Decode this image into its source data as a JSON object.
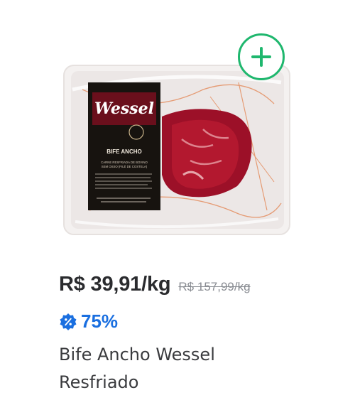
{
  "product": {
    "name": "Bife Ancho Wessel Resfriado",
    "price_current": "R$ 39,91/kg",
    "price_old": "R$ 157,99/kg",
    "discount": "75%",
    "package": {
      "brand": "Wessel",
      "title": "BIFE ANCHO",
      "subtitle_1": "CARNE RESFRIADA DE BOVINO",
      "subtitle_2": "SEM OSSO (FILÉ DE COSTELA)"
    }
  },
  "icons": {
    "add": "plus-circle-icon",
    "discount": "percent-badge-icon"
  },
  "colors": {
    "add_accent": "#1fb76e",
    "discount_accent": "#1a6fe0",
    "price_text": "#2a2b2e",
    "old_price_text": "#8a8d93"
  }
}
